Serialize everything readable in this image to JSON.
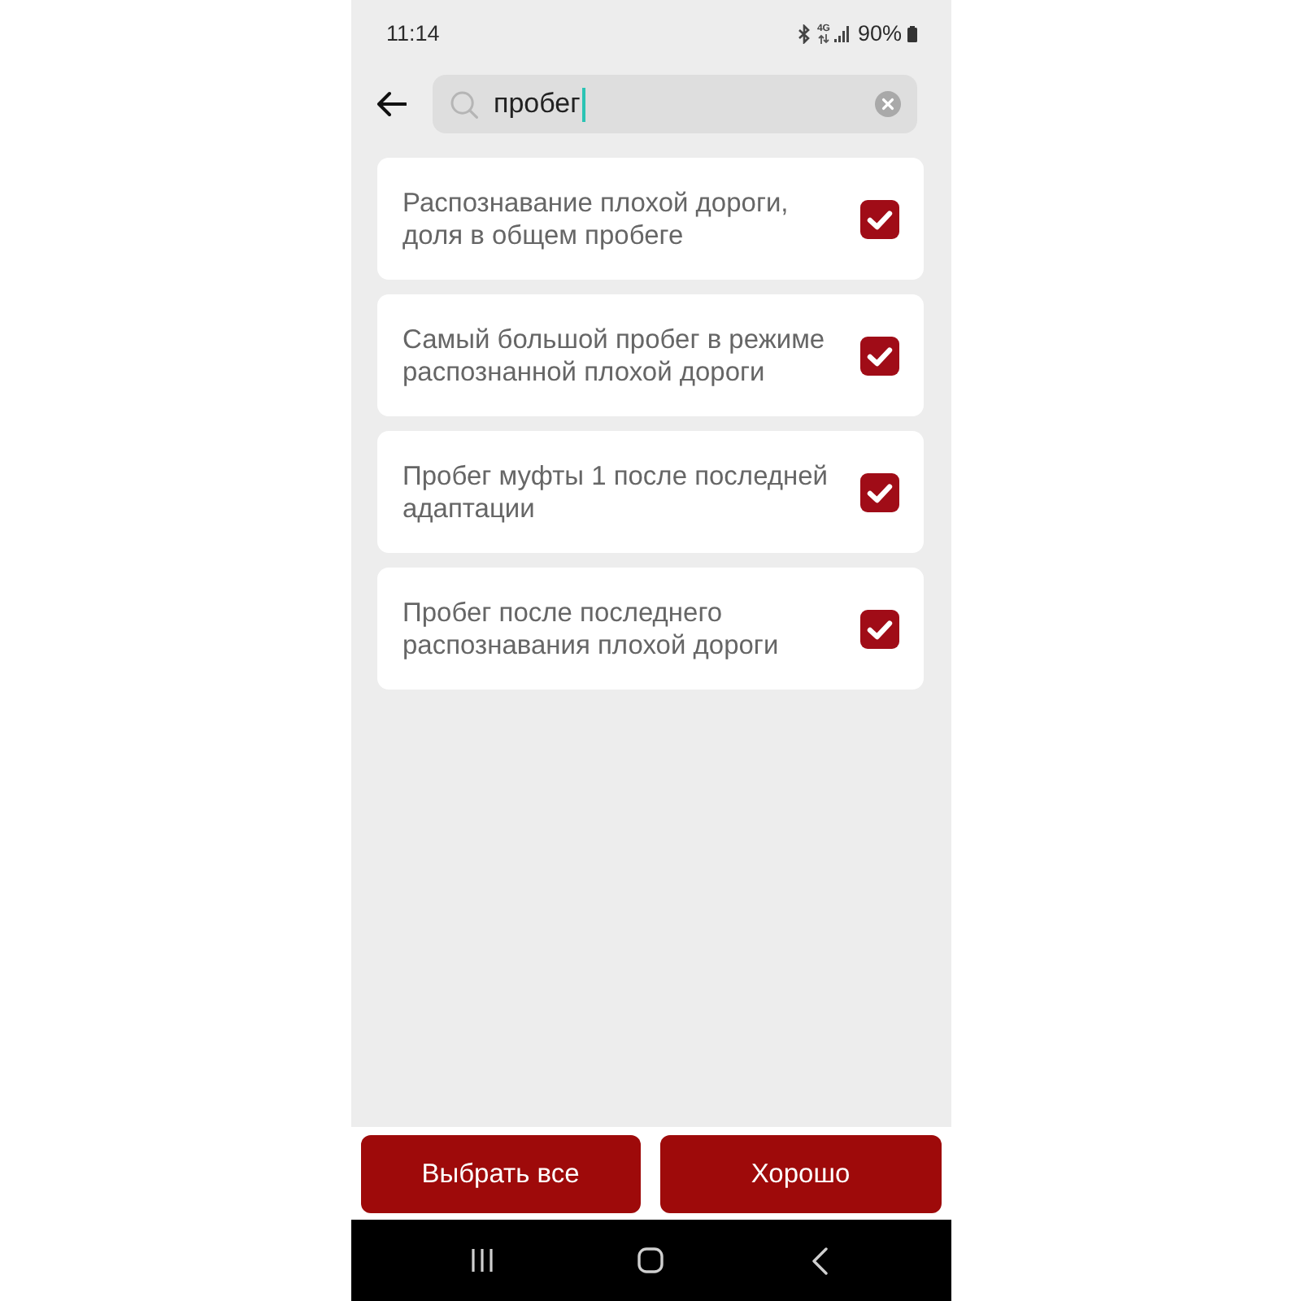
{
  "status_bar": {
    "time": "11:14",
    "network_type": "4G",
    "battery": "90%"
  },
  "search": {
    "value": "пробег"
  },
  "items": [
    {
      "label": "Распознавание плохой дороги, доля в общем пробеге",
      "checked": true
    },
    {
      "label": "Самый большой пробег в режиме распознанной плохой дороги",
      "checked": true
    },
    {
      "label": "Пробег муфты 1 после последней адаптации",
      "checked": true
    },
    {
      "label": "Пробег после последнего распознавания плохой дороги",
      "checked": true
    }
  ],
  "buttons": [
    {
      "label": "Выбрать все"
    },
    {
      "label": "Хорошо"
    }
  ]
}
